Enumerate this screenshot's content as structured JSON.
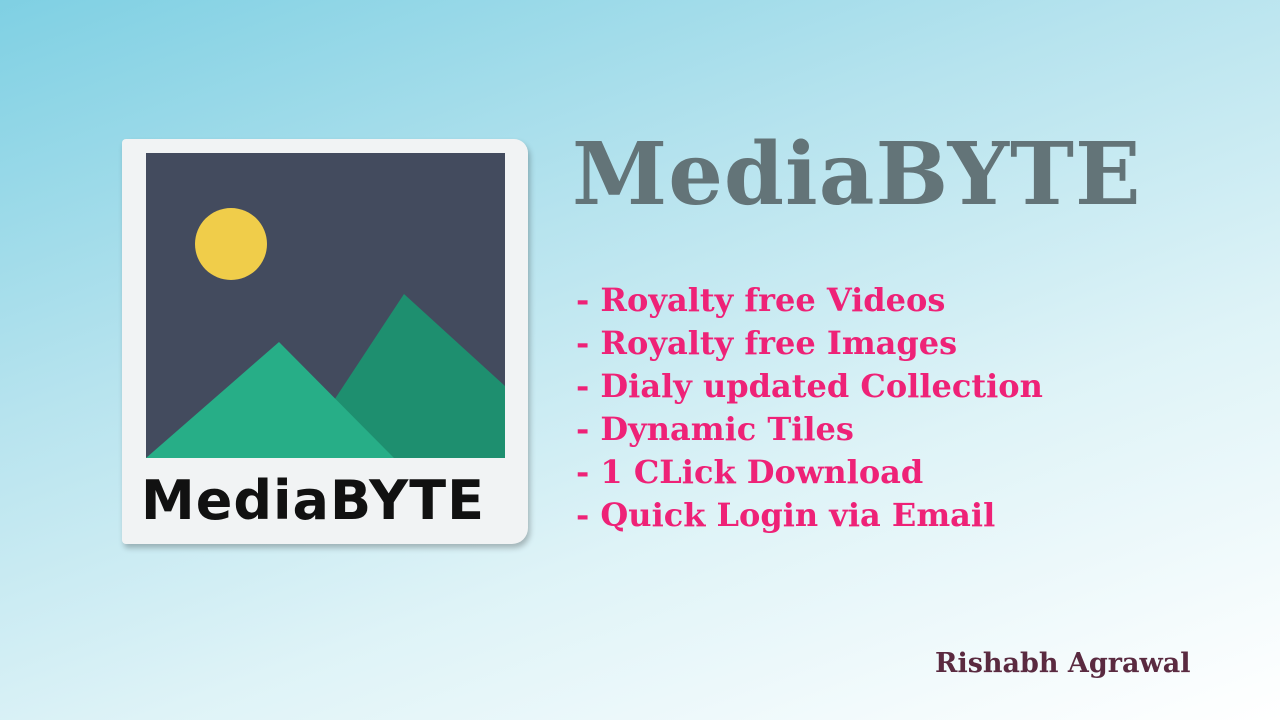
{
  "logo": {
    "label": "MediaBYTE",
    "icon": "image-placeholder-icon",
    "colors": {
      "sky": "#434b5e",
      "sun": "#f0cd4a",
      "mountain_front": "#27ae87",
      "mountain_back": "#1e8f6f",
      "frame": "#f1f3f4"
    }
  },
  "title": "MediaBYTE",
  "features": [
    "- Royalty free Videos",
    "- Royalty free Images",
    "- Dialy updated Collection",
    "- Dynamic Tiles",
    "- 1 CLick Download",
    "- Quick Login via Email"
  ],
  "author": "Rishabh Agrawal",
  "colors": {
    "title": "#637478",
    "features": "#ee2277",
    "author": "#5a2a40"
  }
}
